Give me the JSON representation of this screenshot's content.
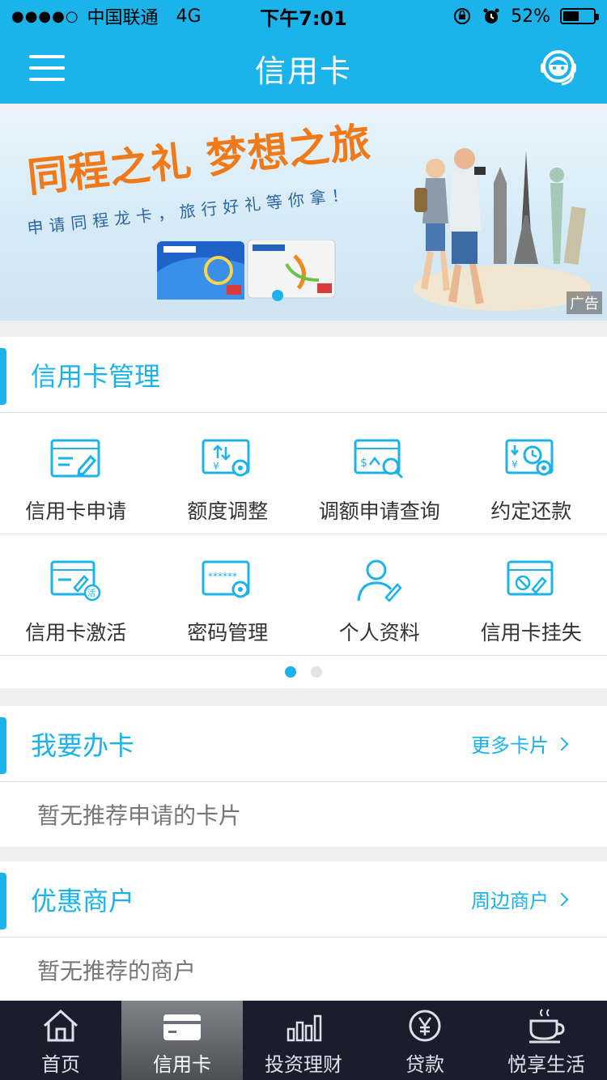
{
  "status_bar": {
    "signal": "●●●●○",
    "carrier": "中国联通",
    "network": "4G",
    "time": "下午7:01",
    "battery_text": "52%",
    "battery_level": 0.52
  },
  "header": {
    "title": "信用卡",
    "menu_icon": "menu-icon",
    "service_icon": "customer-service-icon"
  },
  "banner": {
    "headline": "同程之礼 梦想之旅",
    "subline": "申请同程龙卡，旅行好礼等你拿！",
    "ad_label": "广告",
    "accent_color": "#f07a1a"
  },
  "card_management": {
    "title": "信用卡管理",
    "rows": [
      [
        {
          "label": "信用卡申请",
          "icon": "card-apply-icon"
        },
        {
          "label": "额度调整",
          "icon": "limit-adjust-icon"
        },
        {
          "label": "调额申请查询",
          "icon": "limit-query-icon"
        },
        {
          "label": "约定还款",
          "icon": "scheduled-repay-icon"
        }
      ],
      [
        {
          "label": "信用卡激活",
          "icon": "card-activate-icon"
        },
        {
          "label": "密码管理",
          "icon": "password-icon"
        },
        {
          "label": "个人资料",
          "icon": "profile-icon"
        },
        {
          "label": "信用卡挂失",
          "icon": "card-loss-icon"
        }
      ]
    ]
  },
  "apply_card": {
    "title": "我要办卡",
    "more_label": "更多卡片",
    "empty_text": "暂无推荐申请的卡片"
  },
  "merchants": {
    "title": "优惠商户",
    "more_label": "周边商户",
    "empty_text": "暂无推荐的商户"
  },
  "tabbar": {
    "tabs": [
      {
        "label": "首页",
        "icon": "home-icon",
        "active": false
      },
      {
        "label": "信用卡",
        "icon": "credit-card-icon",
        "active": true
      },
      {
        "label": "投资理财",
        "icon": "chart-bars-icon",
        "active": false
      },
      {
        "label": "贷款",
        "icon": "yen-coin-icon",
        "active": false
      },
      {
        "label": "悦享生活",
        "icon": "coffee-cup-icon",
        "active": false
      }
    ]
  },
  "colors": {
    "brand_blue": "#1ab3ea",
    "tabbar_bg": "#1a1e2c"
  }
}
